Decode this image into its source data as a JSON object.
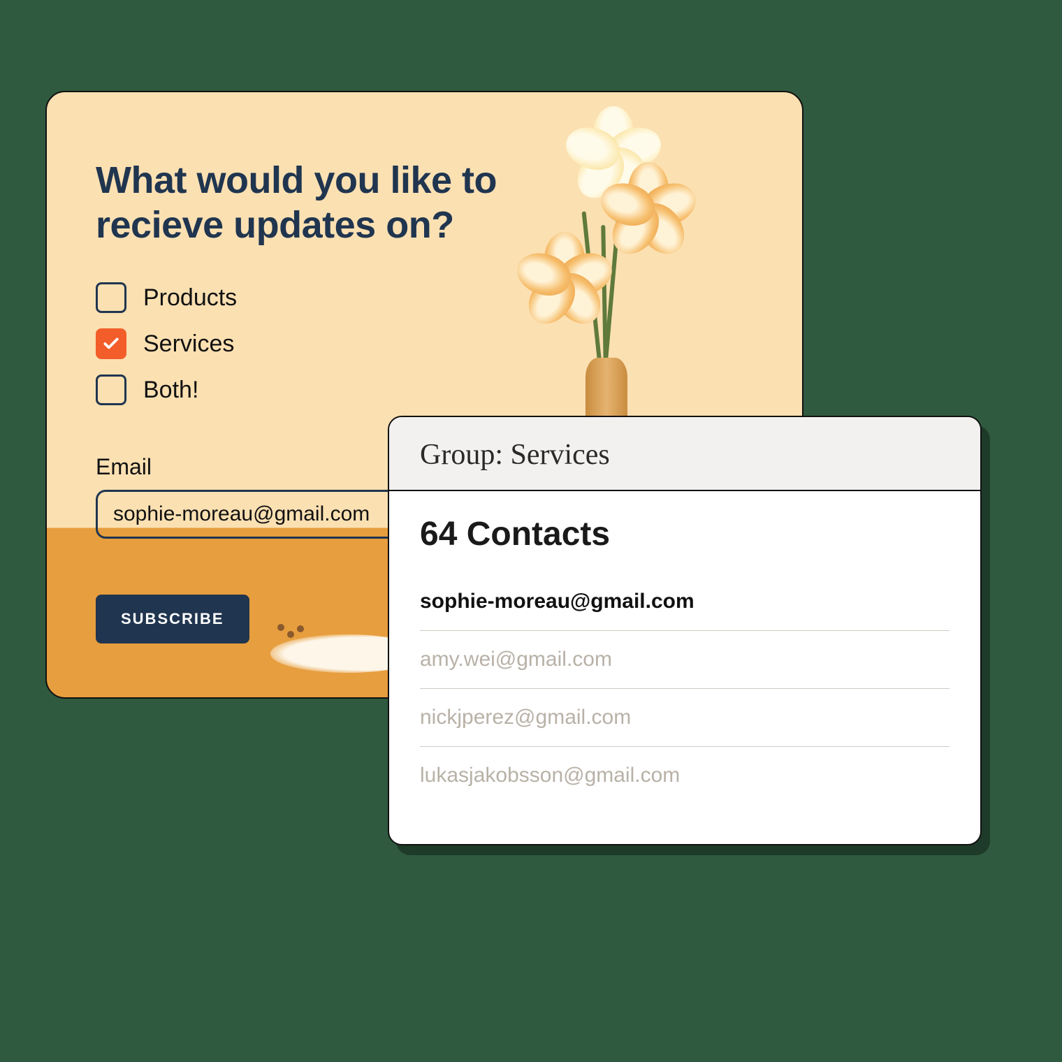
{
  "form": {
    "heading": "What would you like to recieve updates on?",
    "options": [
      {
        "label": "Products",
        "checked": false
      },
      {
        "label": "Services",
        "checked": true
      },
      {
        "label": "Both!",
        "checked": false
      }
    ],
    "email_label": "Email",
    "email_value": "sophie-moreau@gmail.com",
    "subscribe_label": "SUBSCRIBE"
  },
  "contacts": {
    "header": "Group: Services",
    "count_label": "64 Contacts",
    "rows": [
      {
        "email": "sophie-moreau@gmail.com",
        "active": true
      },
      {
        "email": "amy.wei@gmail.com",
        "active": false
      },
      {
        "email": "nickjperez@gmail.com",
        "active": false
      },
      {
        "email": "lukasjakobsson@gmail.com",
        "active": false,
        "cutoff": true
      }
    ]
  },
  "colors": {
    "page_bg": "#2f5a3f",
    "card_bg_top": "#fbe0b2",
    "card_bg_bottom": "#e79e3e",
    "accent_navy": "#20354f",
    "accent_orange": "#f25d2a"
  }
}
